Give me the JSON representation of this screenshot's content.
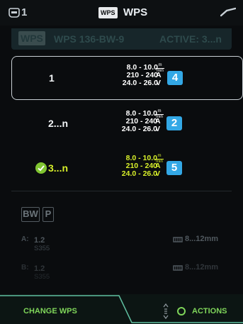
{
  "status": {
    "channel": "1",
    "icon_text": "WPS",
    "title": "WPS"
  },
  "banner": {
    "badge": "WPS",
    "name": "WPS 136-BW-9",
    "active": "ACTIVE: 3...n"
  },
  "rows": [
    {
      "label": "1",
      "wire_speed": "8.0 - 10.0",
      "current": "210 - 240",
      "voltage": "24.0 - 26.0",
      "count": "4",
      "selected": true,
      "active": false
    },
    {
      "label": "2...n",
      "wire_speed": "8.0 - 10.0",
      "current": "210 - 240",
      "voltage": "24.0 - 26.0",
      "count": "2",
      "selected": false,
      "active": false
    },
    {
      "label": "3...n",
      "wire_speed": "8.0 - 10.0",
      "current": "210 - 240",
      "voltage": "24.0 - 26.0",
      "count": "5",
      "selected": false,
      "active": true
    }
  ],
  "units": {
    "speed_top": "m",
    "speed_bottom": "min",
    "current": "A",
    "voltage": "V"
  },
  "detail": {
    "tags": [
      "BW",
      "P"
    ],
    "a": {
      "label": "A:",
      "diameter": "1.2",
      "material": "S355",
      "thickness": "8...12mm"
    },
    "b": {
      "label": "B:",
      "diameter": "1.2",
      "material": "S355",
      "thickness": "8...12mm"
    }
  },
  "footer": {
    "change_label": "CHANGE WPS",
    "actions_label": "ACTIONS"
  },
  "colors": {
    "accent_green": "#7fd55a",
    "active_yellow": "#d8f02a",
    "count_blue": "#33a8e6",
    "check_green": "#80c531"
  }
}
